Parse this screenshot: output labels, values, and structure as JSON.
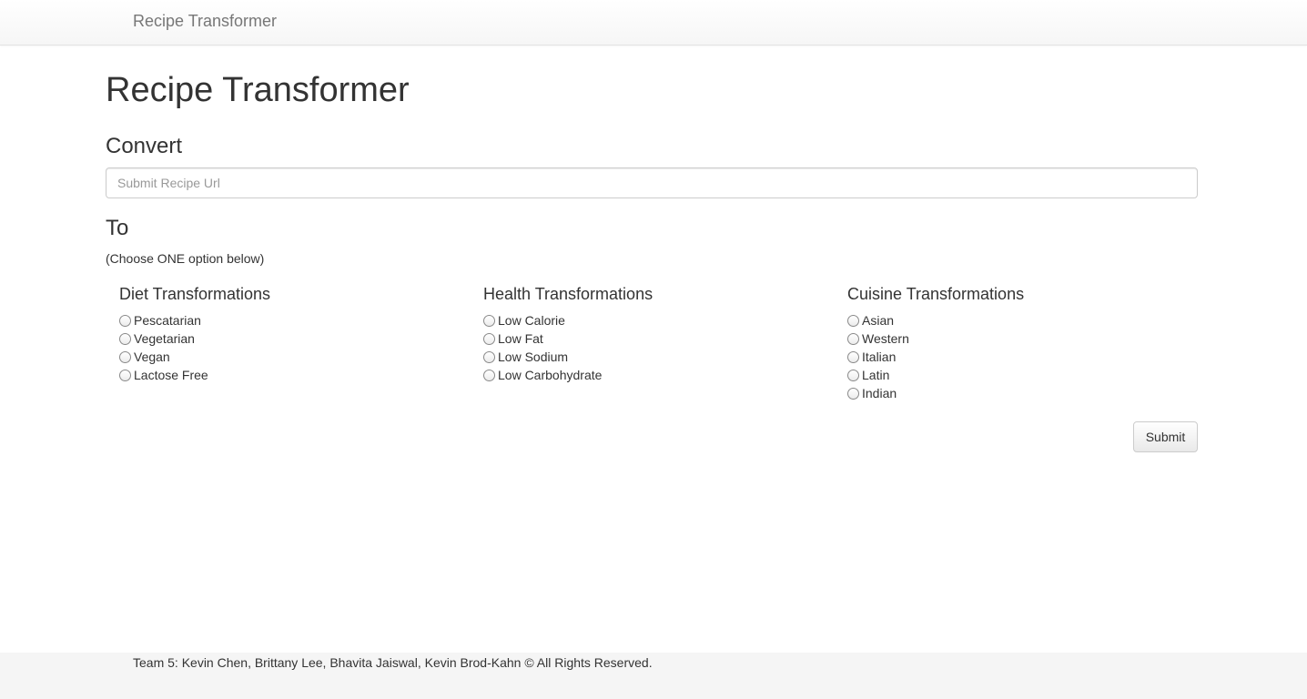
{
  "navbar": {
    "brand": "Recipe Transformer"
  },
  "main": {
    "title": "Recipe Transformer",
    "convert_heading": "Convert",
    "url_input": {
      "placeholder": "Submit Recipe Url",
      "value": ""
    },
    "to_heading": "To",
    "instruction": "(Choose ONE option below)",
    "groups": [
      {
        "title": "Diet Transformations",
        "options": [
          "Pescatarian",
          "Vegetarian",
          "Vegan",
          "Lactose Free"
        ]
      },
      {
        "title": "Health Transformations",
        "options": [
          "Low Calorie",
          "Low Fat",
          "Low Sodium",
          "Low Carbohydrate"
        ]
      },
      {
        "title": "Cuisine Transformations",
        "options": [
          "Asian",
          "Western",
          "Italian",
          "Latin",
          "Indian"
        ]
      }
    ],
    "submit_label": "Submit"
  },
  "footer": {
    "text": "Team 5: Kevin Chen, Brittany Lee, Bhavita Jaiswal, Kevin Brod-Kahn © All Rights Reserved."
  }
}
